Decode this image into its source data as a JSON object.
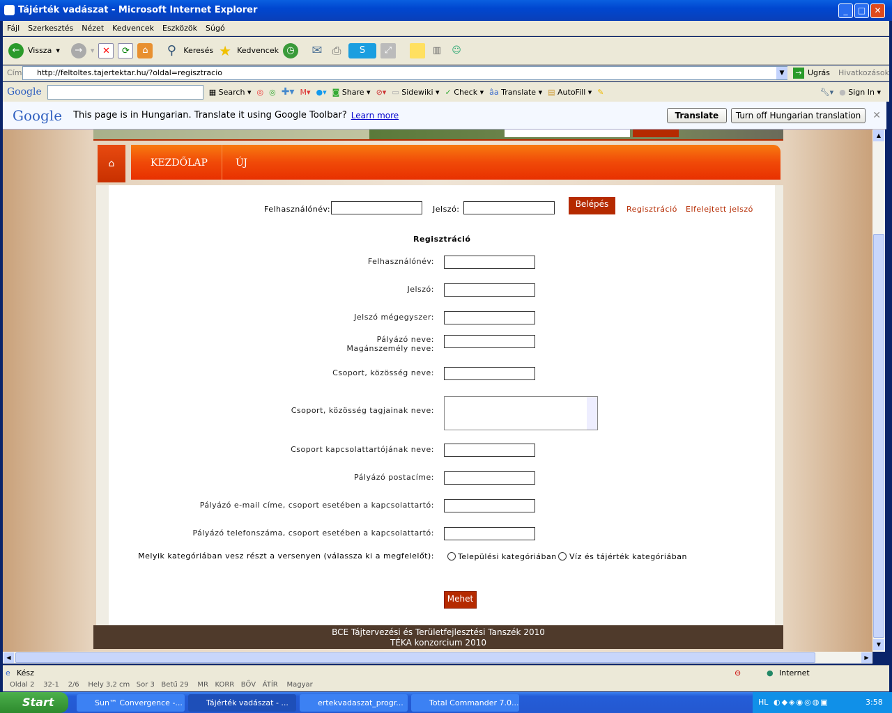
{
  "window": {
    "title": "Tájérték vadászat - Microsoft Internet Explorer"
  },
  "menu": [
    "Fájl",
    "Szerkesztés",
    "Nézet",
    "Kedvencek",
    "Eszközök",
    "Súgó"
  ],
  "toolbar": {
    "back": "Vissza",
    "search": "Keresés",
    "favorites": "Kedvencek"
  },
  "address": {
    "label": "Cím",
    "url": "http://feltoltes.tajertektar.hu/?oldal=regisztracio",
    "go": "Ugrás",
    "links": "Hivatkozások"
  },
  "google_toolbar": {
    "logo": "Google",
    "search": "Search",
    "share": "Share",
    "sidewiki": "Sidewiki",
    "check": "Check",
    "translate": "Translate",
    "autofill": "AutoFill",
    "sign_in": "Sign In"
  },
  "translate_bar": {
    "message": "This page is in Hungarian.  Translate it using Google Toolbar?",
    "learn_more": "Learn more",
    "translate_button": "Translate",
    "turn_off_button": "Turn off Hungarian translation"
  },
  "nav": {
    "items": [
      "KEZDŐLAP",
      "ÚJ"
    ]
  },
  "login": {
    "username_label": "Felhasználónév:",
    "password_label": "Jelszó:",
    "login_button": "Belépés",
    "register_link": "Regisztráció",
    "forgot_link": "Elfelejtett jelszó"
  },
  "form": {
    "title": "Regisztráció",
    "fields": [
      "Felhasználónév:",
      "Jelszó:",
      "Jelszó mégegyszer:",
      "Pályázó neve:\nMagánszemély neve:",
      "Csoport, közösség neve:",
      "Csoport, közösség tagjainak neve:",
      "Csoport kapcsolattartójának neve:",
      "Pályázó postacíme:",
      "Pályázó e-mail címe, csoport esetében a kapcsolattartó:",
      "Pályázó telefonszáma, csoport esetében a kapcsolattartó:"
    ],
    "category_label": "Melyik kategóriában vesz részt a versenyen (válassza ki a megfelelőt):",
    "category_options": [
      "Települési kategóriában",
      "Víz és tájérték kategóriában"
    ],
    "submit": "Mehet"
  },
  "footer": {
    "line1": "BCE Tájtervezési és Területfejlesztési Tanszék 2010",
    "line2": "TÉKA konzorcium 2010"
  },
  "status": {
    "text": "Kész",
    "zone": "Internet"
  },
  "word_status": "Oldal 2    32-1    2/6    Hely 3,2 cm   Sor 3   Betű 29    MR   KORR   BŐV   ÁTÍR    Magyar",
  "taskbar": {
    "start": "Start",
    "tasks": [
      "Sun™ Convergence -...",
      "Tájérték vadászat - ...",
      "ertekvadaszat_progr...",
      "Total Commander 7.0..."
    ],
    "lang": "HL",
    "clock": "3:58"
  },
  "colors": {
    "nav_orange": "#f05010",
    "accent_red": "#b52a00",
    "footer": "#4f3a2b"
  }
}
